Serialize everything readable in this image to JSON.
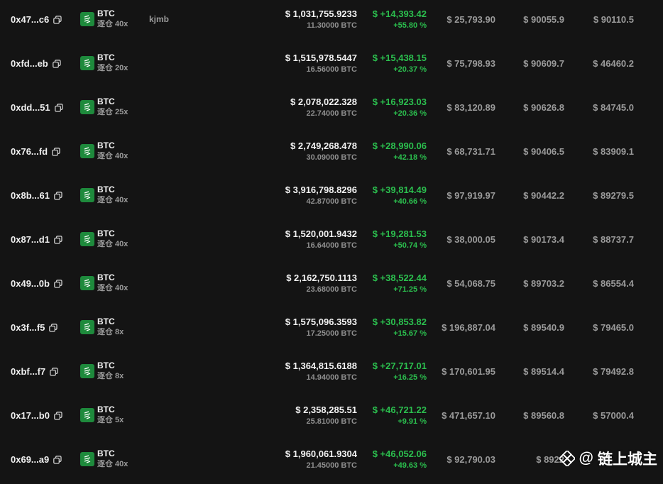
{
  "rows": [
    {
      "addr": "0x47...c6",
      "symbol": "BTC",
      "mode": "逐仓 40x",
      "tag": "kjmb",
      "value_usd": "$ 1,031,755.9233",
      "value_btc": "11.30000 BTC",
      "pnl": "$ +14,393.42",
      "pnl_pct": "+55.80 %",
      "margin": "$ 25,793.90",
      "entry": "$ 90055.9",
      "liq": "$ 90110.5"
    },
    {
      "addr": "0xfd...eb",
      "symbol": "BTC",
      "mode": "逐仓 20x",
      "tag": "",
      "value_usd": "$ 1,515,978.5447",
      "value_btc": "16.56000 BTC",
      "pnl": "$ +15,438.15",
      "pnl_pct": "+20.37 %",
      "margin": "$ 75,798.93",
      "entry": "$ 90609.7",
      "liq": "$ 46460.2"
    },
    {
      "addr": "0xdd...51",
      "symbol": "BTC",
      "mode": "逐仓 25x",
      "tag": "",
      "value_usd": "$ 2,078,022.328",
      "value_btc": "22.74000 BTC",
      "pnl": "$ +16,923.03",
      "pnl_pct": "+20.36 %",
      "margin": "$ 83,120.89",
      "entry": "$ 90626.8",
      "liq": "$ 84745.0"
    },
    {
      "addr": "0x76...fd",
      "symbol": "BTC",
      "mode": "逐仓 40x",
      "tag": "",
      "value_usd": "$ 2,749,268.478",
      "value_btc": "30.09000 BTC",
      "pnl": "$ +28,990.06",
      "pnl_pct": "+42.18 %",
      "margin": "$ 68,731.71",
      "entry": "$ 90406.5",
      "liq": "$ 83909.1"
    },
    {
      "addr": "0x8b...61",
      "symbol": "BTC",
      "mode": "逐仓 40x",
      "tag": "",
      "value_usd": "$ 3,916,798.8296",
      "value_btc": "42.87000 BTC",
      "pnl": "$ +39,814.49",
      "pnl_pct": "+40.66 %",
      "margin": "$ 97,919.97",
      "entry": "$ 90442.2",
      "liq": "$ 89279.5"
    },
    {
      "addr": "0x87...d1",
      "symbol": "BTC",
      "mode": "逐仓 40x",
      "tag": "",
      "value_usd": "$ 1,520,001.9432",
      "value_btc": "16.64000 BTC",
      "pnl": "$ +19,281.53",
      "pnl_pct": "+50.74 %",
      "margin": "$ 38,000.05",
      "entry": "$ 90173.4",
      "liq": "$ 88737.7"
    },
    {
      "addr": "0x49...0b",
      "symbol": "BTC",
      "mode": "逐仓 40x",
      "tag": "",
      "value_usd": "$ 2,162,750.1113",
      "value_btc": "23.68000 BTC",
      "pnl": "$ +38,522.44",
      "pnl_pct": "+71.25 %",
      "margin": "$ 54,068.75",
      "entry": "$ 89703.2",
      "liq": "$ 86554.4"
    },
    {
      "addr": "0x3f...f5",
      "symbol": "BTC",
      "mode": "逐仓 8x",
      "tag": "",
      "value_usd": "$ 1,575,096.3593",
      "value_btc": "17.25000 BTC",
      "pnl": "$ +30,853.82",
      "pnl_pct": "+15.67 %",
      "margin": "$ 196,887.04",
      "entry": "$ 89540.9",
      "liq": "$ 79465.0"
    },
    {
      "addr": "0xbf...f7",
      "symbol": "BTC",
      "mode": "逐仓 8x",
      "tag": "",
      "value_usd": "$ 1,364,815.6188",
      "value_btc": "14.94000 BTC",
      "pnl": "$ +27,717.01",
      "pnl_pct": "+16.25 %",
      "margin": "$ 170,601.95",
      "entry": "$ 89514.4",
      "liq": "$ 79492.8"
    },
    {
      "addr": "0x17...b0",
      "symbol": "BTC",
      "mode": "逐仓 5x",
      "tag": "",
      "value_usd": "$ 2,358,285.51",
      "value_btc": "25.81000 BTC",
      "pnl": "$ +46,721.22",
      "pnl_pct": "+9.91 %",
      "margin": "$ 471,657.10",
      "entry": "$ 89560.8",
      "liq": "$ 57000.4"
    },
    {
      "addr": "0x69...a9",
      "symbol": "BTC",
      "mode": "逐仓 40x",
      "tag": "",
      "value_usd": "$ 1,960,061.9304",
      "value_btc": "21.45000 BTC",
      "pnl": "$ +46,052.06",
      "pnl_pct": "+49.63 %",
      "margin": "$ 92,790.03",
      "entry": "$ 8922",
      "liq": ""
    }
  ],
  "watermark": {
    "at": "@",
    "text": "链上城主"
  },
  "colors": {
    "background": "#141414",
    "profit": "#2bbf4e",
    "asset_logo": "#1e8a3c",
    "muted": "#9a9a9a"
  },
  "icons": {
    "copy": "copy-icon",
    "asset": "asset-logo-icon",
    "watermark_logo": "binance-square-icon"
  }
}
